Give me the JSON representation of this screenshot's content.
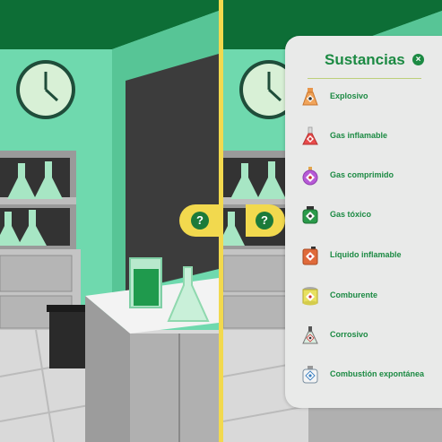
{
  "help_button": {
    "label": "?"
  },
  "substances_panel": {
    "title": "Sustancias",
    "close_label": "×",
    "items": [
      {
        "label": "Explosivo",
        "icon": "explosive-flask-icon"
      },
      {
        "label": "Gas inflamable",
        "icon": "flammable-gas-flask-icon"
      },
      {
        "label": "Gas comprimido",
        "icon": "compressed-gas-flask-icon"
      },
      {
        "label": "Gas tóxico",
        "icon": "toxic-gas-bottle-icon"
      },
      {
        "label": "Líquido inflamable",
        "icon": "flammable-liquid-canister-icon"
      },
      {
        "label": "Comburente",
        "icon": "oxidizer-container-icon"
      },
      {
        "label": "Corrosivo",
        "icon": "corrosive-flask-icon"
      },
      {
        "label": "Combustión expontánea",
        "icon": "spontaneous-combustion-bottle-icon"
      }
    ]
  },
  "colors": {
    "accent": "#1c8a43",
    "highlight": "#f2d94e",
    "wall": "#6fd9ae",
    "ceiling": "#0c6b34"
  }
}
